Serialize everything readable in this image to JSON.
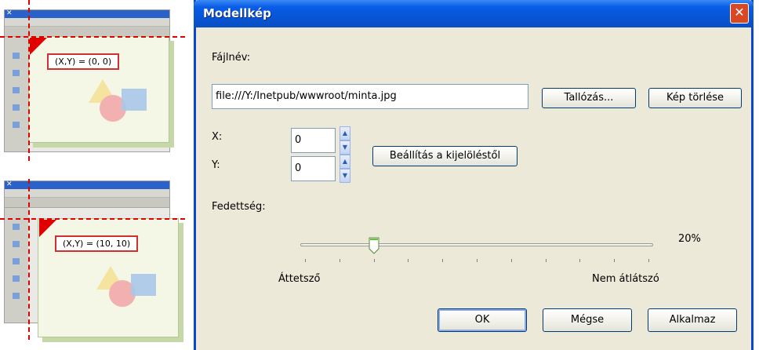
{
  "illustrations": [
    {
      "coord_label": "(X,Y) = (0, 0)"
    },
    {
      "coord_label": "(X,Y) = (10, 10)"
    }
  ],
  "dialog": {
    "title": "Modellkép",
    "close_glyph": "✕",
    "filename_label": "Fájlnév:",
    "filename_value": "file:///Y:/Inetpub/wwwroot/minta.jpg",
    "browse_button": "Tallózás...",
    "delete_button": "Kép törlése",
    "x_label": "X:",
    "x_value": "0",
    "y_label": "Y:",
    "y_value": "0",
    "set_from_selection_button": "Beállítás a kijelöléstől",
    "opacity_label": "Fedettség:",
    "opacity_value_text": "20%",
    "opacity_fraction": 0.2,
    "slider_min_label": "Áttetsző",
    "slider_max_label": "Nem átlátszó",
    "ok_button": "OK",
    "cancel_button": "Mégse",
    "apply_button": "Alkalmaz"
  }
}
